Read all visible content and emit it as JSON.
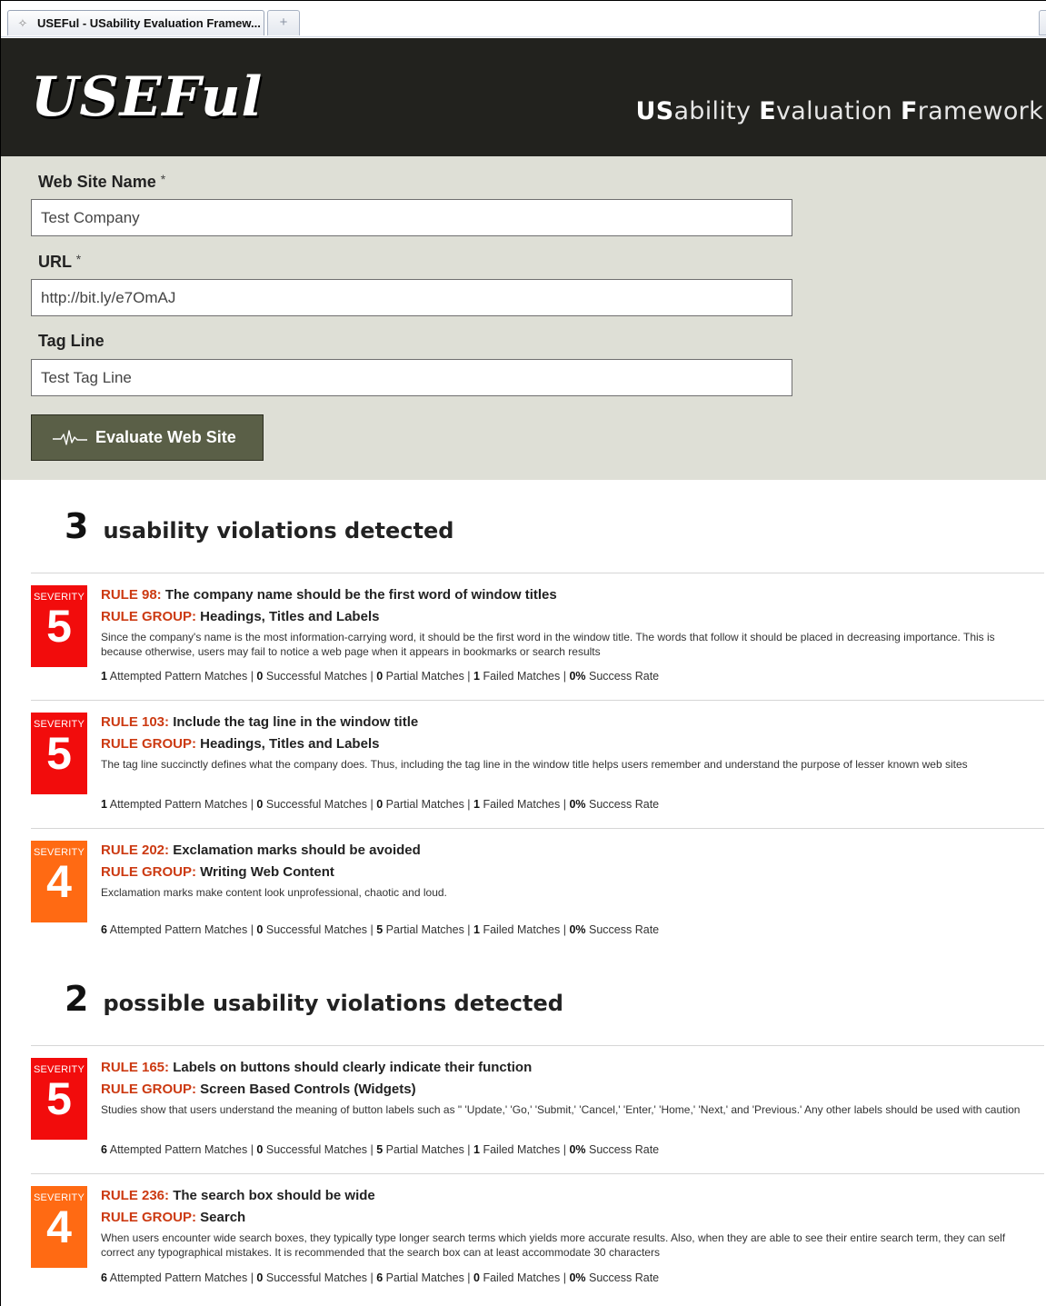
{
  "browser": {
    "tab_title": "USEFul - USability Evaluation Framew...",
    "new_tab_glyph": "+"
  },
  "header": {
    "logo": "USEFul",
    "tagline_parts": [
      {
        "bold": "US",
        "rest": "ability "
      },
      {
        "bold": "E",
        "rest": "valuation "
      },
      {
        "bold": "F",
        "rest": "ramework"
      }
    ]
  },
  "form": {
    "site_name_label": "Web Site Name",
    "site_name_value": "Test Company",
    "url_label": "URL",
    "url_value": "http://bit.ly/e7OmAJ",
    "tagline_label": "Tag Line",
    "tagline_value": "Test Tag Line",
    "required_mark": "*",
    "evaluate_button": "Evaluate Web Site",
    "evaluate_icon": "heartbeat-icon"
  },
  "stats_labels": {
    "attempted": "Attempted Pattern Matches",
    "successful": "Successful Matches",
    "partial": "Partial Matches",
    "failed": "Failed Matches",
    "rate": "Success Rate"
  },
  "colors": {
    "severity_5": "#f20c0c",
    "severity_4": "#ff6a13",
    "rule_key": "#cc3a12",
    "header_bg": "#22221e",
    "form_bg": "#dedfd6",
    "button_bg": "#5a5f47"
  },
  "sections": [
    {
      "count": "3",
      "title": "usability violations detected",
      "rules": [
        {
          "severity_label": "SEVERITY",
          "severity": "5",
          "rule_prefix": "RULE 98:",
          "rule_title": "The company name should be the first word of window titles",
          "group_prefix": "RULE GROUP:",
          "group": "Headings, Titles and Labels",
          "description": "Since the company's name is the most information-carrying word, it should be the first word in the window title. The words that follow it should be placed in decreasing importance. This is because otherwise, users may fail to notice a web page when it appears in bookmarks or search results",
          "attempted": "1",
          "successful": "0",
          "partial": "0",
          "failed": "1",
          "rate": "0%"
        },
        {
          "severity_label": "SEVERITY",
          "severity": "5",
          "rule_prefix": "RULE 103:",
          "rule_title": "Include the tag line in the window title",
          "group_prefix": "RULE GROUP:",
          "group": "Headings, Titles and Labels",
          "description": "The tag line succinctly defines what the company does. Thus, including the tag line in the window title helps users remember and understand the purpose of lesser known web sites",
          "attempted": "1",
          "successful": "0",
          "partial": "0",
          "failed": "1",
          "rate": "0%"
        },
        {
          "severity_label": "SEVERITY",
          "severity": "4",
          "rule_prefix": "RULE 202:",
          "rule_title": "Exclamation marks should be avoided",
          "group_prefix": "RULE GROUP:",
          "group": "Writing Web Content",
          "description": "Exclamation marks make content look unprofessional, chaotic and loud.",
          "attempted": "6",
          "successful": "0",
          "partial": "5",
          "failed": "1",
          "rate": "0%"
        }
      ]
    },
    {
      "count": "2",
      "title": "possible usability violations detected",
      "rules": [
        {
          "severity_label": "SEVERITY",
          "severity": "5",
          "rule_prefix": "RULE 165:",
          "rule_title": "Labels on buttons should clearly indicate their function",
          "group_prefix": "RULE GROUP:",
          "group": "Screen Based Controls (Widgets)",
          "description": "Studies show that users understand the meaning of button labels such as \" 'Update,' 'Go,' 'Submit,' 'Cancel,' 'Enter,' 'Home,' 'Next,' and 'Previous.' Any other labels should be used with caution",
          "attempted": "6",
          "successful": "0",
          "partial": "5",
          "failed": "1",
          "rate": "0%"
        },
        {
          "severity_label": "SEVERITY",
          "severity": "4",
          "rule_prefix": "RULE 236:",
          "rule_title": "The search box should be wide",
          "group_prefix": "RULE GROUP:",
          "group": "Search",
          "description": "When users encounter wide search boxes, they typically type longer search terms which yields more accurate results. Also, when they are able to see their entire search term, they can self correct any typographical mistakes. It is recommended that the search box can at least accommodate 30 characters",
          "attempted": "6",
          "successful": "0",
          "partial": "6",
          "failed": "0",
          "rate": "0%"
        }
      ]
    }
  ]
}
